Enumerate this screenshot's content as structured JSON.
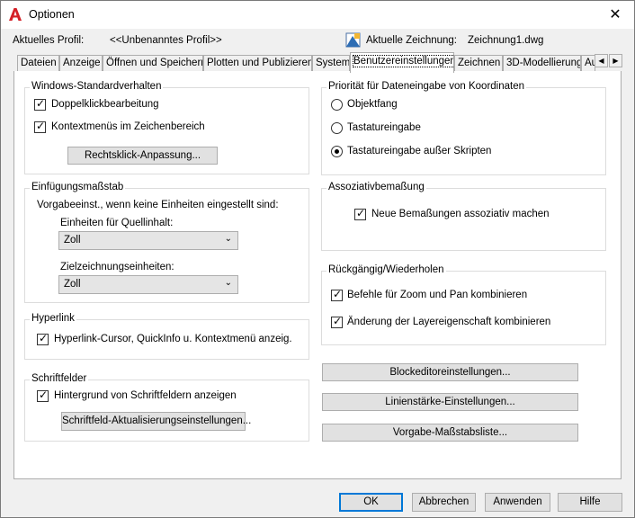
{
  "window": {
    "title": "Optionen",
    "close_glyph": "✕"
  },
  "header": {
    "profile_label": "Aktuelles Profil:",
    "profile_value": "<<Unbenanntes Profil>>",
    "drawing_label": "Aktuelle Zeichnung:",
    "drawing_value": "Zeichnung1.dwg"
  },
  "tabs": [
    {
      "label": "Dateien"
    },
    {
      "label": "Anzeige"
    },
    {
      "label": "Öffnen und Speichern"
    },
    {
      "label": "Plotten und Publizieren"
    },
    {
      "label": "System"
    },
    {
      "label": "Benutzereinstellungen",
      "active": true
    },
    {
      "label": "Zeichnen"
    },
    {
      "label": "3D-Modellierung"
    },
    {
      "label": "Au"
    }
  ],
  "tab_scroll": {
    "left": "◀",
    "right": "▶"
  },
  "windows_standard": {
    "title": "Windows-Standardverhalten",
    "double_click": "Doppelklickbearbeitung",
    "context_menus": "Kontextmenüs im Zeichenbereich",
    "right_click_button": "Rechtsklick-Anpassung..."
  },
  "insertion_scale": {
    "title": "Einfügungsmaßstab",
    "description": "Vorgabeeinst., wenn keine Einheiten eingestellt sind:",
    "source_label": "Einheiten für Quellinhalt:",
    "source_value": "Zoll",
    "target_label": "Zielzeichnungseinheiten:",
    "target_value": "Zoll"
  },
  "hyperlink": {
    "title": "Hyperlink",
    "option": "Hyperlink-Cursor, QuickInfo u. Kontextmenü anzeig."
  },
  "fields": {
    "title": "Schriftfelder",
    "background": "Hintergrund von Schriftfeldern anzeigen",
    "update_button": "Schriftfeld-Aktualisierungseinstellungen..."
  },
  "coord_priority": {
    "title": "Priorität für Dateneingabe von Koordinaten",
    "options": [
      "Objektfang",
      "Tastatureingabe",
      "Tastatureingabe außer Skripten"
    ],
    "selected_index": 2
  },
  "assoc_dim": {
    "title": "Assoziativbemaßung",
    "option": "Neue Bemaßungen assoziativ machen"
  },
  "undo_redo": {
    "title": "Rückgängig/Wiederholen",
    "zoom_pan": "Befehle für Zoom und Pan kombinieren",
    "layer_changes": "Änderung der Layereigenschaft kombinieren"
  },
  "right_buttons": {
    "block_editor": "Blockeditoreinstellungen...",
    "lineweight": "Linienstärke-Einstellungen...",
    "scale_list": "Vorgabe-Maßstabsliste..."
  },
  "footer": {
    "ok": "OK",
    "cancel": "Abbrechen",
    "apply": "Anwenden",
    "help": "Hilfe"
  },
  "colors": {
    "accent": "#0078d7",
    "app_icon": "#d42027"
  },
  "icons": {
    "app": "autocad-logo-icon",
    "drawing": "drawing-file-icon",
    "chevron": "chevron-down-icon"
  }
}
